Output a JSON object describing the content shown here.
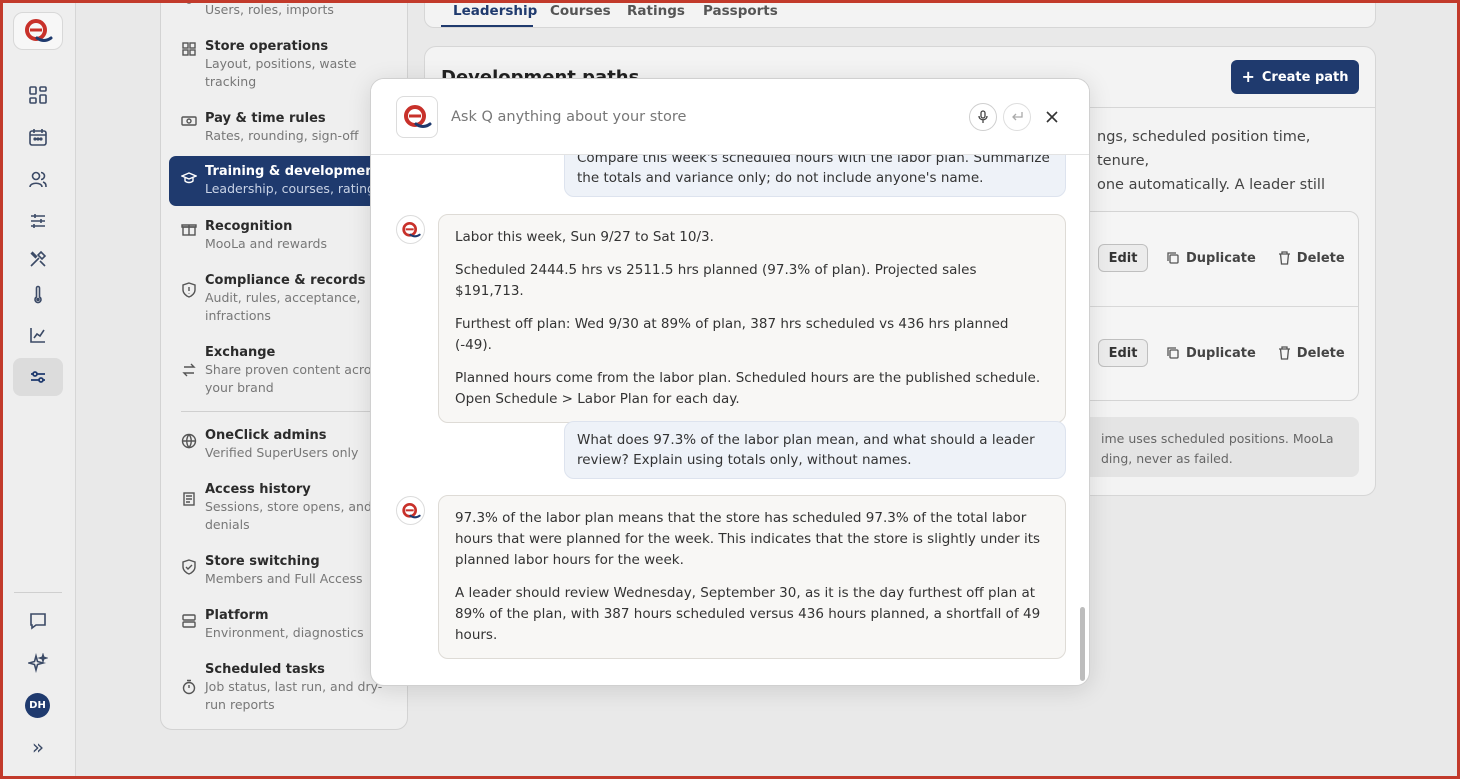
{
  "colors": {
    "brand_navy": "#1f3a6e",
    "brand_red": "#c8312a",
    "frame": "#c23a2b"
  },
  "rail": {
    "icons": [
      "dashboard-icon",
      "calendar-icon",
      "people-icon",
      "sliders-icon",
      "tools-icon",
      "thermometer-icon",
      "chart-icon",
      "settings-sliders-icon"
    ],
    "bottom_icons": [
      "chat-icon",
      "sparkle-icon"
    ],
    "avatar_initials": "DH",
    "expand_glyph": "»"
  },
  "sidebar": {
    "items": [
      {
        "title": "",
        "subtitle": "Users, roles, imports",
        "icon": "person-icon"
      },
      {
        "title": "Store operations",
        "subtitle": "Layout, positions, waste tracking",
        "icon": "grid-icon"
      },
      {
        "title": "Pay & time rules",
        "subtitle": "Rates, rounding, sign-off",
        "icon": "cash-icon"
      },
      {
        "title": "Training & development",
        "subtitle": "Leadership, courses, ratings",
        "icon": "graduation-icon",
        "active": true
      },
      {
        "title": "Recognition",
        "subtitle": "MooLa and rewards",
        "icon": "gift-icon"
      },
      {
        "title": "Compliance & records",
        "subtitle": "Audit, rules, acceptance, infractions",
        "icon": "shield-icon"
      },
      {
        "title": "Exchange",
        "subtitle": "Share proven content across your brand",
        "icon": "swap-icon"
      },
      {
        "title": "OneClick admins",
        "subtitle": "Verified SuperUsers only",
        "icon": "globe-icon"
      },
      {
        "title": "Access history",
        "subtitle": "Sessions, store opens, and denials",
        "icon": "log-icon"
      },
      {
        "title": "Store switching",
        "subtitle": "Members and Full Access",
        "icon": "shield-check-icon"
      },
      {
        "title": "Platform",
        "subtitle": "Environment, diagnostics",
        "icon": "server-icon"
      },
      {
        "title": "Scheduled tasks",
        "subtitle": "Job status, last run, and dry-run reports",
        "icon": "timer-icon"
      }
    ]
  },
  "tabs": [
    "Leadership",
    "Courses",
    "Ratings",
    "Passports"
  ],
  "dev": {
    "title": "Development paths",
    "create_label": "Create path",
    "text_line1": "ngs, scheduled position time, tenure,",
    "text_line2": "one automatically. A leader still",
    "edit_label": "Edit",
    "duplicate_label": "Duplicate",
    "delete_label": "Delete",
    "note_line1": "ime uses scheduled positions. MooLa",
    "note_line2": "ding, never as failed."
  },
  "assistant": {
    "placeholder": "Ask Q anything about your store",
    "messages": [
      {
        "role": "user",
        "text": "Compare this week's scheduled hours with the labor plan. Summarize the totals and variance only; do not include anyone's name."
      },
      {
        "role": "assistant",
        "paragraphs": [
          "Labor this week, Sun 9/27 to Sat 10/3.",
          "Scheduled 2444.5 hrs vs 2511.5 hrs planned (97.3% of plan). Projected sales $191,713.",
          "Furthest off plan: Wed 9/30 at 89% of plan, 387 hrs scheduled vs 436 hrs planned (-49).",
          "Planned hours come from the labor plan. Scheduled hours are the published schedule. Open Schedule > Labor Plan for each day."
        ]
      },
      {
        "role": "user",
        "text": "What does 97.3% of the labor plan mean, and what should a leader review? Explain using totals only, without names."
      },
      {
        "role": "assistant",
        "paragraphs": [
          "97.3% of the labor plan means that the store has scheduled 97.3% of the total labor hours that were planned for the week. This indicates that the store is slightly under its planned labor hours for the week.",
          "A leader should review Wednesday, September 30, as it is the day furthest off plan at 89% of the plan, with 387 hours scheduled versus 436 hours planned, a shortfall of 49 hours."
        ]
      }
    ]
  }
}
